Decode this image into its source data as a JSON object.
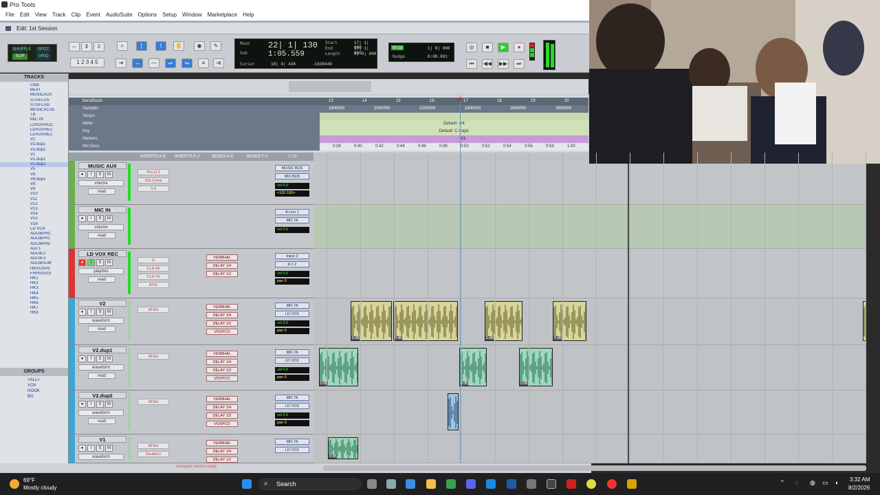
{
  "window": {
    "title": "Pro Tools",
    "edit_title": "Edit: 1st Session"
  },
  "menu": [
    "File",
    "Edit",
    "View",
    "Track",
    "Clip",
    "Event",
    "AudioSuite",
    "Options",
    "Setup",
    "Window",
    "Marketplace",
    "Help"
  ],
  "modes": {
    "shuffle": "SHUFFLE",
    "spot": "SPOT",
    "slip": "SLIP",
    "grid": "GRID"
  },
  "counters": {
    "main_label": "Main",
    "main_value": "22| 1| 130",
    "sub_label": "Sub",
    "sub_value": "1:05.559",
    "start_label": "Start",
    "start_value": "17| 1| 000",
    "end_label": "End",
    "end_value": "17| 1| 000",
    "length_label": "Length",
    "length_value": "0| 0| 000",
    "cursor_label": "Cursor",
    "cursor_value": "18| 4| 438",
    "sample_value": "-1638449",
    "grid_label": "Grid",
    "grid_value": "1| 0| 000",
    "nudge_label": "Nudge",
    "nudge_value": "0:00.001"
  },
  "sidebar": {
    "tracks_header": "TRACKS",
    "tracks": [
      "Click",
      "BEAT",
      "MUSICAUX",
      "STGFLUS",
      "STGFLUG",
      "MUSICXCVE",
      "TB",
      "MIC IN",
      "LDVOXRCE",
      "LDVOXRE1",
      "LDVOXRE2",
      "V2",
      "V2.dup1",
      "V2.dup2",
      "V1",
      "V1.dup1",
      "V1.dup2",
      "V5",
      "V6",
      "V8.dup1",
      "V8",
      "V9",
      "V10",
      "V11",
      "V12",
      "V13",
      "V14",
      "V15",
      "V16",
      "LD VOX",
      "ADLIBPRC",
      "ADLIBPH1",
      "ADLIBPH2",
      "Aux 1",
      "ADLIB.2",
      "ADLIB.3",
      "ADLIBSUM",
      "HKVOXRE",
      "FRHG0519",
      "HK1",
      "HK2",
      "HK3",
      "HK4",
      "HK5",
      "HK6",
      "HK7",
      "HK8"
    ],
    "groups_header": "GROUPS",
    "groups": [
      "<ALL>",
      "VOX",
      "HOOK",
      "BG"
    ]
  },
  "rulers": {
    "bars_beats": "Bars|Beats",
    "samples": "Samples",
    "tempo": "Tempo",
    "meter": "Meter",
    "key": "Key",
    "markers": "Markers",
    "min_secs": "Min:Secs",
    "meter_value": "Default: 4/4",
    "key_value": "Default: C major",
    "marker_value": "V1",
    "bars": [
      "13",
      "14",
      "15",
      "16",
      "17",
      "18",
      "19",
      "20"
    ],
    "samples_ticks": [
      "1800000",
      "2000000",
      "2200000",
      "2400000",
      "2600000",
      "2800000"
    ],
    "time_ticks": [
      "0:38",
      "0:40",
      "0:42",
      "0:44",
      "0:46",
      "0:48",
      "0:50",
      "0:52",
      "0:54",
      "0:56",
      "0:58",
      "1:00"
    ]
  },
  "mix_headers": {
    "inserts_ae": "INSERTS A-E",
    "inserts_fj": "INSERTS F-J",
    "sends_ae": "SENDS A-E",
    "sends_fj": "SENDS F-J",
    "io": "I / O"
  },
  "tracks": [
    {
      "name": "MUSIC AUX",
      "mode": "volume",
      "auto": "read",
      "ins": [
        "Pro-Q 3",
        "SSLComp",
        "3-3"
      ],
      "io_in": "MUSIC BUS",
      "io_out": "MIX BUS",
      "vol": "vol 0.0",
      "pan": "<100 100>"
    },
    {
      "name": "MIC IN",
      "mode": "volume",
      "auto": "read",
      "ins": [],
      "io_in": "A Line 1",
      "io_out": "MIC IN",
      "vol": "vol 0.0",
      "pan": ""
    },
    {
      "name": "LD VOX REC",
      "mode": "playlists",
      "auto": "read",
      "ins": [
        "G",
        "CLA 2A",
        "CLA-76",
        "AT6k"
      ],
      "sends": [
        "VERBHAL",
        "DELAY 1/4",
        "DELAY 1/2"
      ],
      "io_in": "Input 2",
      "io_out": "A 1-2",
      "vol": "vol 0.0",
      "pan": "pan 0"
    },
    {
      "name": "V2",
      "mode": "waveform",
      "auto": "read",
      "ins": [
        "ATEfx"
      ],
      "sends": [
        "VERBHAL",
        "DELAY 1/4",
        "DELAY 1/2",
        "VOXPCO"
      ],
      "io_in": "MIC IN",
      "io_out": "LD VOX",
      "vol": "vol 0.0",
      "pan": "pan 0"
    },
    {
      "name": "V2.dup1",
      "mode": "waveform",
      "auto": "read",
      "ins": [
        "ATEfx"
      ],
      "sends": [
        "VERBHAL",
        "DELAY 1/4",
        "DELAY 1/2",
        "VOXPCO"
      ],
      "io_in": "MIC IN",
      "io_out": "LD VOX",
      "vol": "vol 0.0",
      "pan": "pan 0"
    },
    {
      "name": "V2.dup2",
      "mode": "waveform",
      "auto": "read",
      "ins": [
        "ATEfx"
      ],
      "sends": [
        "VERBHAL",
        "DELAY 1/4",
        "DELAY 1/2",
        "VOXPCO"
      ],
      "io_in": "MIC IN",
      "io_out": "LD VOX",
      "vol": "vol 0.0",
      "pan": "pan 0"
    },
    {
      "name": "V1",
      "mode": "waveform",
      "auto": "read",
      "ins": [
        "ATEfx",
        "Doubler2"
      ],
      "sends": [
        "VERBHAL",
        "DELAY 1/4",
        "DELAY 1/2"
      ],
      "io_in": "MIC IN",
      "io_out": "LD VOX",
      "vol": "",
      "pan": ""
    }
  ],
  "clip_gain": "0 dB",
  "status": "transport record ready",
  "taskbar": {
    "temp": "69°F",
    "weather": "Mostly cloudy",
    "search": "Search",
    "time": "3:32 AM",
    "date": "8/2/2026"
  }
}
